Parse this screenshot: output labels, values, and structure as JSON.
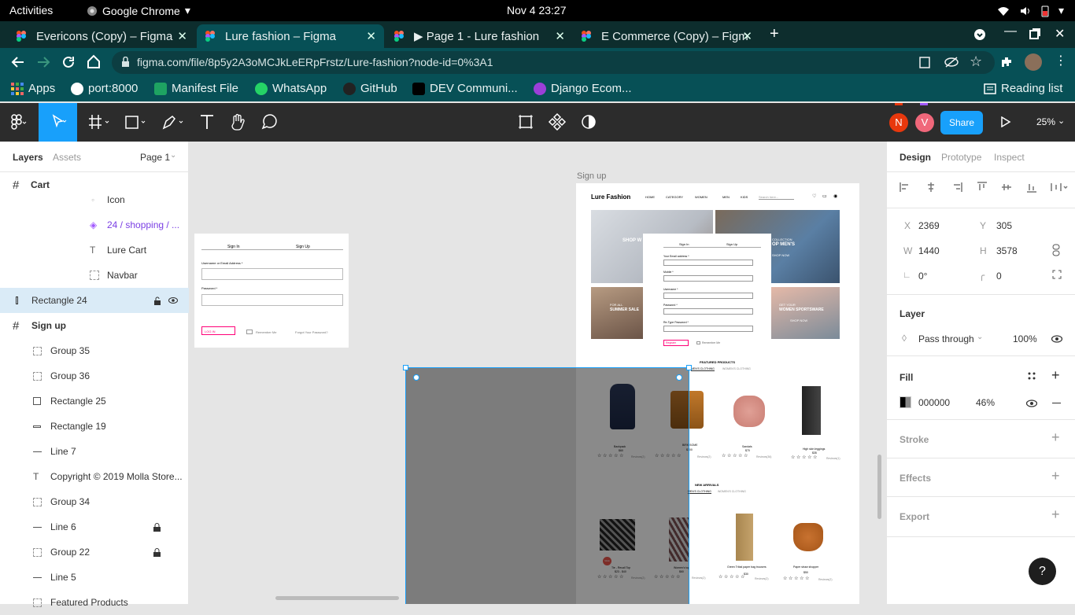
{
  "gnome": {
    "activities": "Activities",
    "app": "Google Chrome",
    "clock": "Nov 4  23:27"
  },
  "tabs": [
    {
      "label": "Evericons (Copy) – Figma"
    },
    {
      "label": "Lure fashion – Figma"
    },
    {
      "label": "▶ Page 1 - Lure fashion"
    },
    {
      "label": "E Commerce (Copy) – Figm"
    }
  ],
  "address": {
    "url": "figma.com/file/8p5y2A3oMCJkLeERpFrstz/Lure-fashion?node-id=0%3A1"
  },
  "bookmarks": [
    "Apps",
    "port:8000",
    "Manifest File",
    "WhatsApp",
    "GitHub",
    "DEV Communi...",
    "Django Ecom...",
    "Reading list"
  ],
  "toolbar": {
    "share": "Share",
    "zoom": "25%",
    "avatars": [
      "N",
      "V"
    ]
  },
  "left": {
    "tabs": {
      "layers": "Layers",
      "assets": "Assets",
      "page": "Page 1"
    },
    "layers": [
      {
        "name": "Cart"
      },
      {
        "name": "Icon"
      },
      {
        "name": "24 / shopping / ..."
      },
      {
        "name": "Lure Cart"
      },
      {
        "name": "Navbar"
      },
      {
        "name": "Rectangle 24"
      },
      {
        "name": "Sign up"
      },
      {
        "name": "Group 35"
      },
      {
        "name": "Group 36"
      },
      {
        "name": "Rectangle 25"
      },
      {
        "name": "Rectangle 19"
      },
      {
        "name": "Line 7"
      },
      {
        "name": "Copyright © 2019 Molla Store..."
      },
      {
        "name": "Group 34"
      },
      {
        "name": "Line 6"
      },
      {
        "name": "Group 22"
      },
      {
        "name": "Line 5"
      },
      {
        "name": "Featured Products"
      }
    ]
  },
  "canvas": {
    "frame_label": "Sign up",
    "signin_tab": "Sign In",
    "signup_tab": "Sign Up",
    "login_field_label": "Username or Email Address *",
    "login_pass_label": "Password *",
    "login_button": "LOG IN",
    "remember": "Remember Me",
    "forgot": "Forgot Your Password?",
    "brand": "Lure Fashion",
    "nav": [
      "HOME",
      "CATEGORY",
      "WOMEN",
      "MEN",
      "KIDS"
    ],
    "search_placeholder": "Search here...",
    "hero_left_caption": "SHOP W",
    "hero_right_top": "COLLECTION",
    "hero_right_caption": "OP MEN'S",
    "hero_right_link": "SHOP NOW",
    "promo_left_small": "FOR ALL",
    "promo_left_caption": "SUMMER SALE",
    "promo_right_small": "GET YOUR",
    "promo_right_caption": "WOMEN SPORTSWARE",
    "promo_right_link": "SHOP NOW",
    "modal_tabs": [
      "Sign In",
      "Sign Up"
    ],
    "modal_fields": [
      "Your Email address *",
      "Mobile *",
      "Username *",
      "Password *",
      "Re-Type Password *"
    ],
    "register_button": "Register",
    "featured_title": "FEATURED PRODUCTS",
    "featured_tabs": [
      "MEN'S CLOTHING",
      "WOMEN'S CLOTHING"
    ],
    "featured_products": [
      {
        "name": "Backpack",
        "price": "$60",
        "reviews": "Reviews(2)"
      },
      {
        "name": "BIRK SOME",
        "price": "$100",
        "reviews": "Reviews(2)"
      },
      {
        "name": "Sandals",
        "price": "$70",
        "reviews": "Reviews(36)"
      },
      {
        "name": "High skin leggings",
        "price": "$35",
        "reviews": "Reviews(1)"
      }
    ],
    "arrivals_title": "NEW ARRIVALS",
    "arrivals_tabs": [
      "MEN'S CLOTHING",
      "WOMEN'S CLOTHING"
    ],
    "arrivals_products": [
      {
        "name": "Tie - Recall Top",
        "price": "$23 - $40",
        "reviews": "Reviews(2)",
        "badge": "SALE"
      },
      {
        "name": "Women's top",
        "price": "$60",
        "reviews": "Reviews(2)"
      },
      {
        "name": "Green Tribal paper bag trousers",
        "price": "$30",
        "reviews": "Reviews(2)"
      },
      {
        "name": "Paper straw shopper",
        "price": "$50",
        "reviews": "Reviews(2)"
      }
    ]
  },
  "right": {
    "tabs": [
      "Design",
      "Prototype",
      "Inspect"
    ],
    "x": "2369",
    "y": "305",
    "w": "1440",
    "h": "3578",
    "rot": "0°",
    "radius": "0",
    "x_label": "X",
    "y_label": "Y",
    "w_label": "W",
    "h_label": "H",
    "layer_title": "Layer",
    "blend": "Pass through",
    "opacity": "100%",
    "fill_title": "Fill",
    "fill_hex": "000000",
    "fill_opacity": "46%",
    "stroke": "Stroke",
    "effects": "Effects",
    "export": "Export",
    "help": "?"
  },
  "colors": {
    "figma_blue": "#18a0fb",
    "chrome_tab": "#075056",
    "toolbar": "#2c2c2c"
  }
}
